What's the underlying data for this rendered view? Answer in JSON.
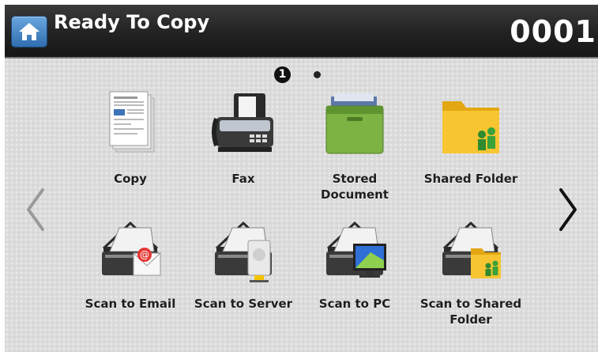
{
  "header": {
    "title": "Ready To Copy",
    "counter": "0001"
  },
  "pager": {
    "current_page": "1",
    "total_pages": 2
  },
  "apps": [
    {
      "label": "Copy",
      "icon": "copy-document-icon"
    },
    {
      "label": "Fax",
      "icon": "fax-machine-icon"
    },
    {
      "label": "Stored\nDocument",
      "icon": "stored-document-box-icon"
    },
    {
      "label": "Shared Folder",
      "icon": "shared-folder-icon"
    },
    {
      "label": "Scan to Email",
      "icon": "scan-to-email-icon"
    },
    {
      "label": "Scan to Server",
      "icon": "scan-to-server-icon"
    },
    {
      "label": "Scan to PC",
      "icon": "scan-to-pc-icon"
    },
    {
      "label": "Scan to Shared\nFolder",
      "icon": "scan-to-shared-folder-icon"
    }
  ],
  "colors": {
    "header_bg": "#222222",
    "home_button": "#3f7fc2",
    "screen_bg": "#dcdcdc"
  }
}
